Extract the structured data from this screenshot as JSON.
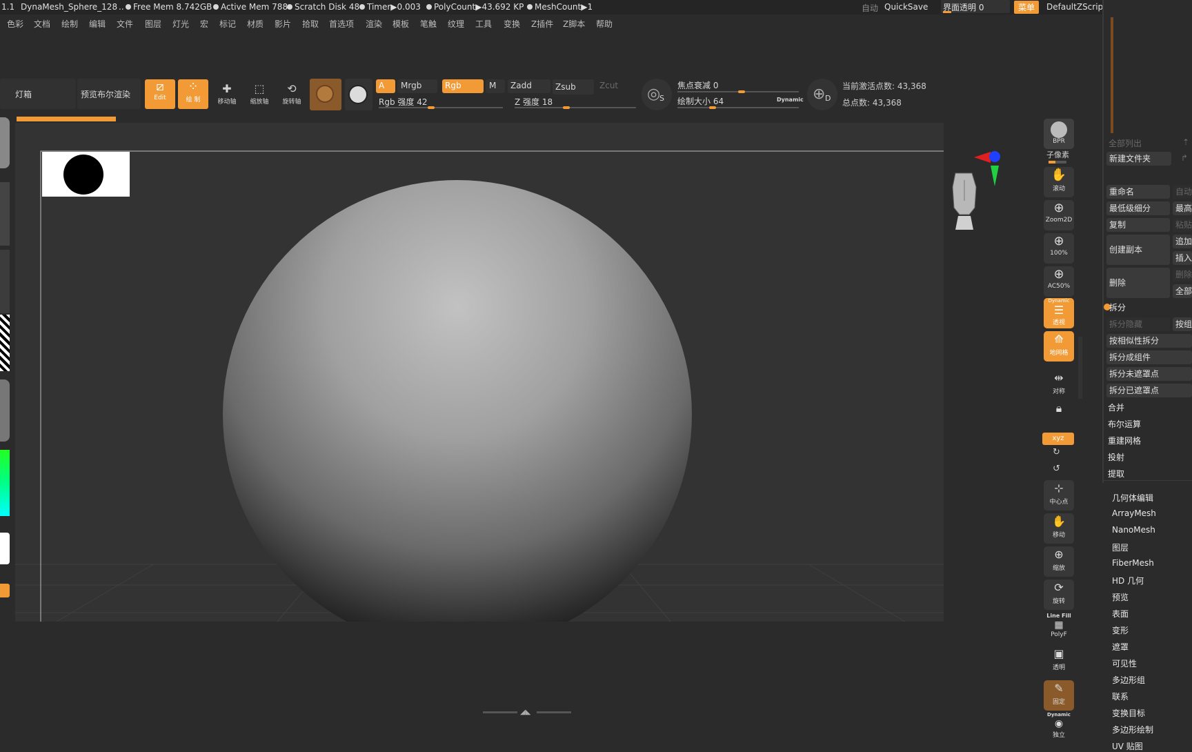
{
  "statusbar": {
    "version": "1.1",
    "document": "DynaMesh_Sphere_128",
    "sep": "..",
    "free_mem": "Free Mem 8.742GB",
    "active_mem": "Active Mem 788",
    "scratch_disk": "Scratch Disk 48",
    "timer": "Timer▶0.003",
    "polycount": "PolyCount▶43.692 KP",
    "meshcount": "MeshCount▶1",
    "auto": "自动",
    "quicksave": "QuickSave",
    "interface_transparency": "界面透明 0",
    "menu": "菜单",
    "script": "DefaultZScript"
  },
  "menubar": [
    "色彩",
    "文档",
    "绘制",
    "编辑",
    "文件",
    "图层",
    "灯光",
    "宏",
    "标记",
    "材质",
    "影片",
    "拾取",
    "首选项",
    "渲染",
    "模板",
    "笔触",
    "纹理",
    "工具",
    "变换",
    "Z插件",
    "Z脚本",
    "帮助"
  ],
  "toolbar": {
    "lightbox": "灯箱",
    "preview_bool": "预览布尔渲染",
    "edit": "Edit",
    "draw": "绘 制",
    "move": "移动轴",
    "scale": "缩放轴",
    "rotate": "旋转轴",
    "a": "A",
    "mrgb": "Mrgb",
    "rgb": "Rgb",
    "m": "M",
    "zadd": "Zadd",
    "zsub": "Zsub",
    "zcut": "Zcut",
    "rgb_intensity": "Rgb 强度 42",
    "z_intensity": "Z 强度 18",
    "focal_shift": "焦点衰减 0",
    "draw_size": "绘制大小 64",
    "dynamic": "Dynamic",
    "s": "S",
    "d": "D",
    "active_points": "当前激活点数: 43,368",
    "total_points": "总点数: 43,368",
    "rgb_intensity_value": 42,
    "z_intensity_value": 18,
    "draw_size_value": 64
  },
  "side_icons": [
    "BPR",
    "子像素",
    "滚动",
    "Zoom2D",
    "100%",
    "AC50%",
    "透视",
    "地网格",
    "对称",
    "锁定",
    "xyz",
    "中心点",
    "移动",
    "缩放",
    "旋转",
    "PolyF",
    "透明",
    "固定",
    "独立"
  ],
  "side_text": {
    "line_fill": "Line Fill",
    "dynamic_top": "Dynamic",
    "dynamic_bottom": "Dynamic"
  },
  "rpanel": {
    "list_all": "全部列出",
    "new_folder": "新建文件夹",
    "rename": "重命名",
    "auto": "自动",
    "lowest_sub": "最低级细分",
    "highest": "最高",
    "copy": "复制",
    "paste": "粘贴",
    "create_copy": "创建副本",
    "append": "追加",
    "insert": "插入",
    "delete": "删除",
    "del2": "删除",
    "all": "全部",
    "split": "拆分",
    "split_hidden": "拆分隐藏",
    "by_group": "按组",
    "by_similar": "按相似性拆分",
    "split_to_groups": "拆分成组件",
    "split_unmasked": "拆分未遮罩点",
    "split_masked": "拆分已遮罩点",
    "merge": "合并",
    "boolean": "布尔运算",
    "remesh": "重建网格",
    "project": "投射",
    "extract": "提取",
    "sections": [
      "几何体编辑",
      "ArrayMesh",
      "NanoMesh",
      "图层",
      "FiberMesh",
      "HD 几何",
      "预览",
      "表面",
      "变形",
      "遮罩",
      "可见性",
      "多边形组",
      "联系",
      "变换目标",
      "多边形绘制",
      "UV 贴图"
    ]
  },
  "colors": {
    "accent": "#f29a35",
    "bg": "#2b2b2b",
    "viewport": "#333333"
  }
}
